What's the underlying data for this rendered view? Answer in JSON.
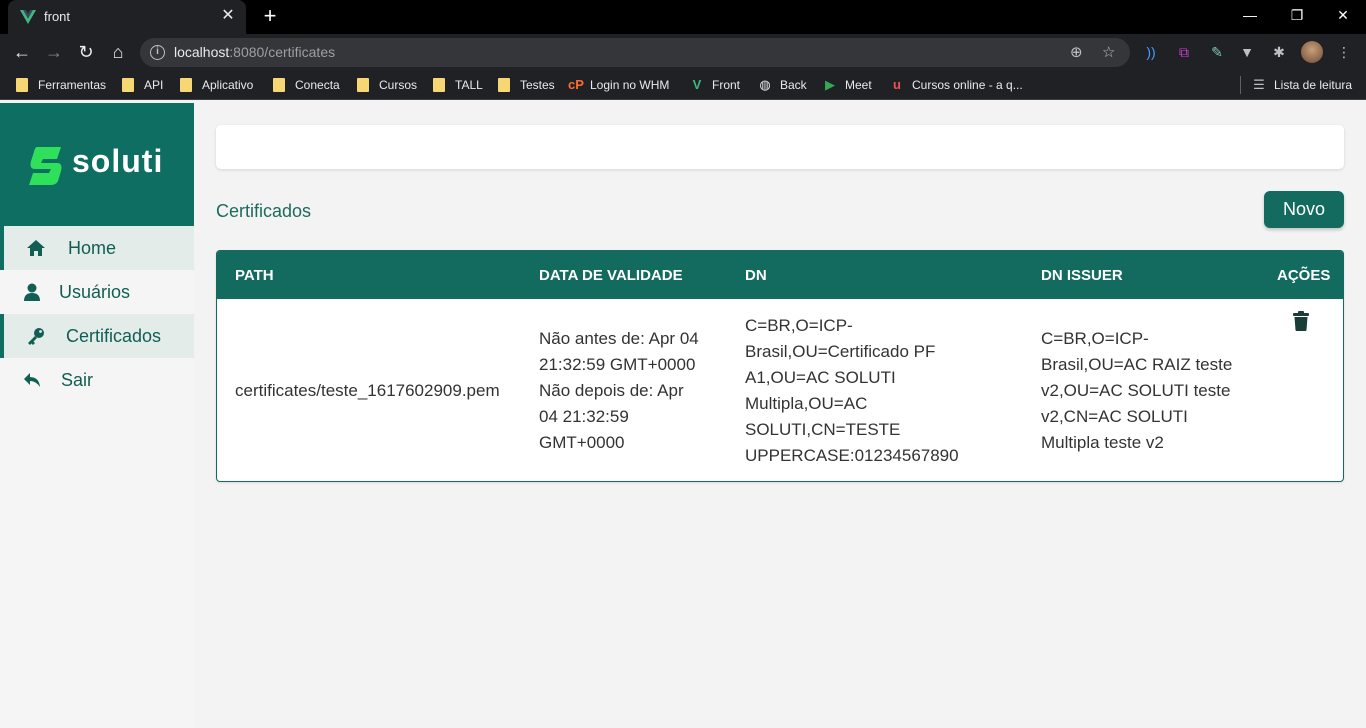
{
  "browser": {
    "tab_title": "front",
    "url_host": "localhost",
    "url_rest": ":8080/certificates",
    "bookmarks": [
      {
        "label": "Ferramentas",
        "icon": "folder-icon"
      },
      {
        "label": "API",
        "icon": "folder-icon"
      },
      {
        "label": "Aplicativo",
        "icon": "folder-icon"
      },
      {
        "label": "Conecta",
        "icon": "folder-icon"
      },
      {
        "label": "Cursos",
        "icon": "folder-icon"
      },
      {
        "label": "TALL",
        "icon": "folder-icon"
      },
      {
        "label": "Testes",
        "icon": "folder-icon"
      },
      {
        "label": "Login no WHM",
        "icon": "cpanel-icon"
      },
      {
        "label": "Front",
        "icon": "vue-icon"
      },
      {
        "label": "Back",
        "icon": "globe-icon"
      },
      {
        "label": "Meet",
        "icon": "meet-icon"
      },
      {
        "label": "Cursos online - a q...",
        "icon": "udemy-icon"
      }
    ],
    "reading_list": "Lista de leitura"
  },
  "app": {
    "brand": "soluti",
    "nav": [
      {
        "label": "Home",
        "icon": "home-icon",
        "active": true
      },
      {
        "label": "Usuários",
        "icon": "user-icon",
        "active": false
      },
      {
        "label": "Certificados",
        "icon": "key-icon",
        "active": true
      },
      {
        "label": "Sair",
        "icon": "logout-icon",
        "active": false
      }
    ],
    "page_title": "Certificados",
    "new_button": "Novo",
    "table": {
      "headers": [
        "PATH",
        "DATA DE VALIDADE",
        "DN",
        "DN ISSUER",
        "AÇÕES"
      ],
      "rows": [
        {
          "path": "certificates/teste_1617602909.pem",
          "validity": [
            "Não antes de: Apr 04",
            "21:32:59 GMT+0000",
            "Não depois de: Apr",
            "04 21:32:59",
            "GMT+0000"
          ],
          "dn": [
            "C=BR,O=ICP-",
            "Brasil,OU=Certificado PF",
            "A1,OU=AC SOLUTI",
            "Multipla,OU=AC",
            "SOLUTI,CN=TESTE",
            "UPPERCASE:01234567890"
          ],
          "dn_issuer": [
            "C=BR,O=ICP-",
            "Brasil,OU=AC RAIZ teste",
            "v2,OU=AC SOLUTI teste",
            "v2,CN=AC SOLUTI",
            "Multipla teste v2"
          ]
        }
      ]
    }
  },
  "colors": {
    "brand": "#0f6e62",
    "header": "#126b5e",
    "accent_green": "#2ecc40"
  }
}
